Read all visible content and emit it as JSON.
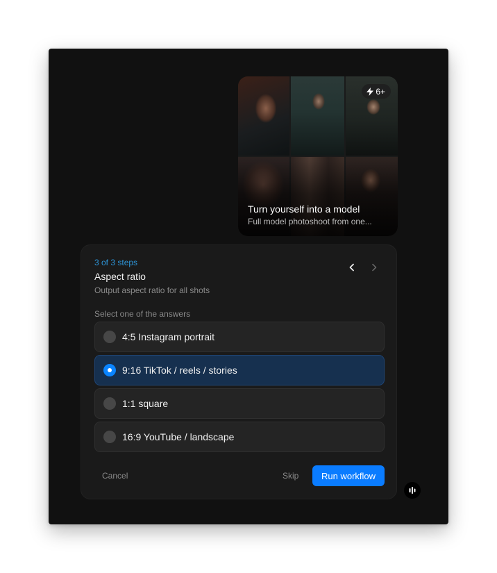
{
  "workflow_card": {
    "badge": "6+",
    "title": "Turn yourself into a model",
    "subtitle": "Full model photoshoot from one..."
  },
  "step": {
    "counter": "3 of 3 steps",
    "title": "Aspect ratio",
    "description": "Output aspect ratio for all shots",
    "prompt": "Select one of the answers",
    "options": [
      {
        "label": "4:5 Instagram portrait",
        "selected": false
      },
      {
        "label": "9:16 TikTok / reels / stories",
        "selected": true
      },
      {
        "label": "1:1 square",
        "selected": false
      },
      {
        "label": "16:9 YouTube / landscape",
        "selected": false
      }
    ]
  },
  "actions": {
    "cancel": "Cancel",
    "skip": "Skip",
    "run": "Run workflow"
  },
  "colors": {
    "accent": "#0a7cff",
    "step_counter": "#2d95d8",
    "selected_option_bg": "#16304f"
  },
  "icons": {
    "badge": "lightning-bolt-icon",
    "nav_prev": "chevron-left-icon",
    "nav_next": "chevron-right-icon",
    "activity": "audio-bars-icon"
  }
}
